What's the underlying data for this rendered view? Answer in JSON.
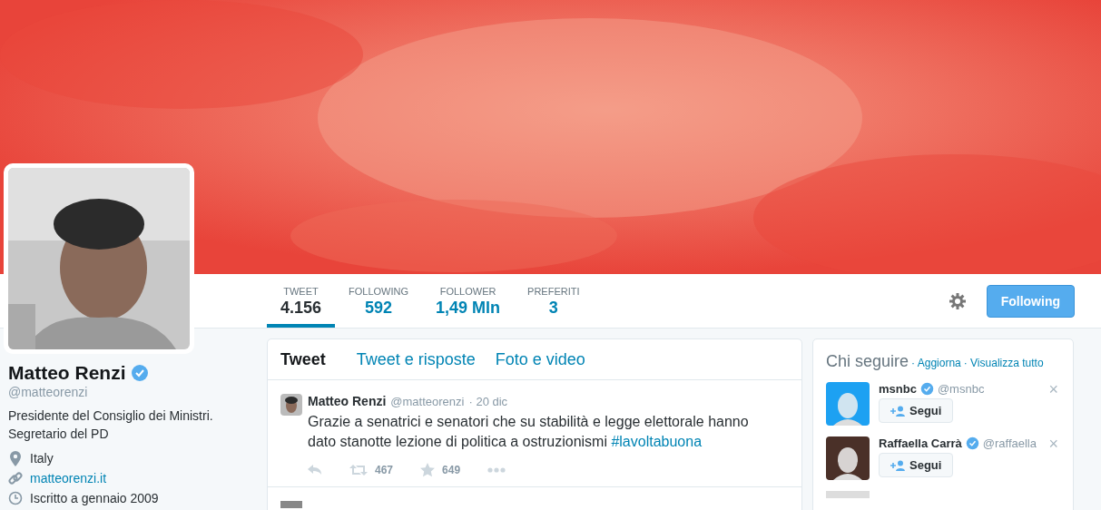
{
  "profile": {
    "name": "Matteo Renzi",
    "verified": true,
    "handle": "@matteorenzi",
    "bio": "Presidente del Consiglio dei Ministri. Segretario del PD",
    "details": [
      {
        "kind": "location",
        "text": "Italy"
      },
      {
        "kind": "link",
        "text": "matteorenzi.it"
      },
      {
        "kind": "joined",
        "text": "Iscritto a gennaio 2009"
      }
    ]
  },
  "stats": [
    {
      "label": "TWEET",
      "value": "4.156",
      "selected": true
    },
    {
      "label": "FOLLOWING",
      "value": "592",
      "selected": false
    },
    {
      "label": "FOLLOWER",
      "value": "1,49 Mln",
      "selected": false
    },
    {
      "label": "PREFERITI",
      "value": "3",
      "selected": false
    }
  ],
  "follow_button": "Following",
  "timeline_tabs": [
    {
      "label": "Tweet",
      "selected": true
    },
    {
      "label": "Tweet e risposte",
      "selected": false
    },
    {
      "label": "Foto e video",
      "selected": false
    }
  ],
  "tweets": [
    {
      "name": "Matteo Renzi",
      "handle": "@matteorenzi",
      "time": "· 20 dic",
      "text": "Grazie a senatrici e senatori che su stabilità e legge elettorale hanno dato stanotte lezione di politica a ostruzionismi",
      "hashtag": "#lavoltabuona",
      "retweets": "467",
      "favorites": "649"
    }
  ],
  "who_to_follow": {
    "title": "Chi seguire",
    "refresh": "· Aggiorna",
    "view_all": "· Visualizza tutto",
    "users": [
      {
        "name": "msnbc",
        "verified": true,
        "handle": "@msnbc",
        "button": "Segui",
        "close": "×",
        "color": "#1da1f2"
      },
      {
        "name": "Raffaella Carrà",
        "verified": true,
        "handle": "@raffaella",
        "button": "Segui",
        "close": "×",
        "color": "#4a3028"
      }
    ]
  }
}
